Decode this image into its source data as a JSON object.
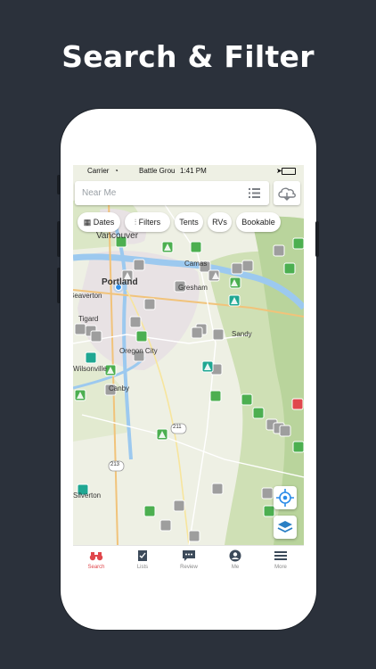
{
  "headline": "Search & Filter",
  "status": {
    "carrier": "Carrier",
    "title": "Battle Grou",
    "time": "1:41 PM"
  },
  "search": {
    "placeholder": "Near Me"
  },
  "chips": [
    {
      "label": "Dates",
      "icon": "calendar-icon"
    },
    {
      "label": "Filters",
      "icon": "sliders-icon"
    },
    {
      "label": "Tents"
    },
    {
      "label": "RVs"
    },
    {
      "label": "Bookable"
    }
  ],
  "map_labels": {
    "vancouver": "Vancouver",
    "camas": "Camas",
    "portland": "Portland",
    "beaverton": "Beaverton",
    "gresham": "Gresham",
    "tigard": "Tigard",
    "sandy": "Sandy",
    "oregon_city": "Oregon City",
    "wilsonville": "Wilsonville",
    "canby": "Canby",
    "silverton": "Silverton",
    "route_211": "211",
    "route_213": "213"
  },
  "tabs": [
    {
      "label": "Search",
      "icon": "binoculars-icon",
      "active": true
    },
    {
      "label": "Lists",
      "icon": "checklist-icon"
    },
    {
      "label": "Review",
      "icon": "review-bubble-icon"
    },
    {
      "label": "Me",
      "icon": "profile-icon"
    },
    {
      "label": "More",
      "icon": "hamburger-menu-icon"
    }
  ],
  "colors": {
    "accent": "#e0474c",
    "background": "#2b313b",
    "marker_green": "#4caf50",
    "marker_gray": "#9e9e9e",
    "marker_teal": "#1fa792"
  }
}
